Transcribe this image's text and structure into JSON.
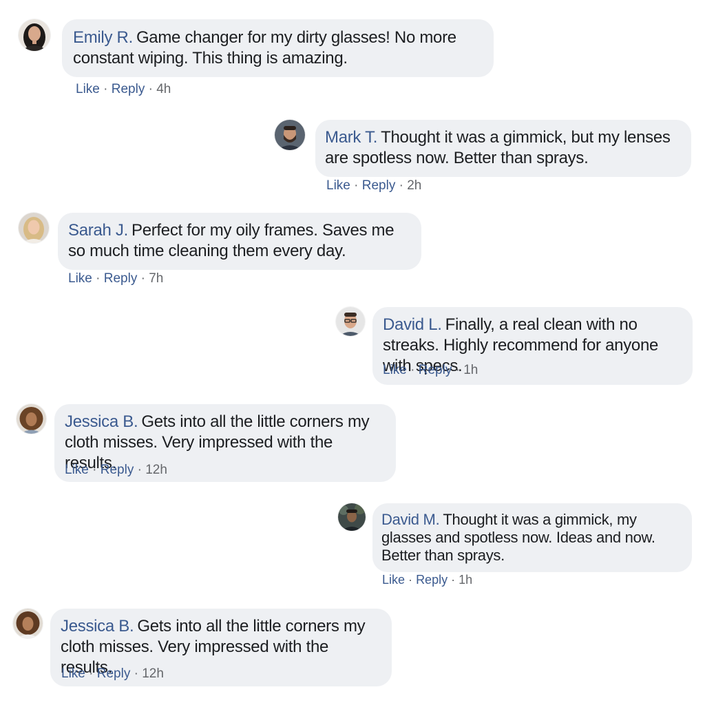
{
  "actions": {
    "like": "Like",
    "reply": "Reply",
    "separator": "·"
  },
  "comments": [
    {
      "author": "Emily R.",
      "text": "Game changer for my dirty glasses! No more constant wiping. This thing is amazing.",
      "time": "4h",
      "avatar": "avatar-emily-icon"
    },
    {
      "author": "Mark T.",
      "text": "Thought it was a gimmick, but my lenses are spotless now. Better than sprays.",
      "time": "2h",
      "avatar": "avatar-mark-icon"
    },
    {
      "author": "Sarah J.",
      "text": "Perfect for my oily frames. Saves me so much time cleaning them every day.",
      "time": "7h",
      "avatar": "avatar-sarah-icon"
    },
    {
      "author": "David L.",
      "text": "Finally, a real clean with no streaks. Highly recommend for anyone with specs.",
      "time": "1h",
      "avatar": "avatar-david-l-icon"
    },
    {
      "author": "Jessica B.",
      "text": "Gets into all the little corners my cloth misses. Very impressed with the results.",
      "time": "12h",
      "avatar": "avatar-jessica-icon"
    },
    {
      "author": "David M.",
      "text": "Thought it was a gimmick, my glasses and spotless now. Ideas and now. Better than sprays.",
      "time": "1h",
      "avatar": "avatar-david-m-icon"
    },
    {
      "author": "Jessica B.",
      "text": "Gets into all the little corners my cloth misses. Very impressed with the results.",
      "time": "12h",
      "avatar": "avatar-jessica-icon"
    }
  ],
  "colors": {
    "bubble": "#eef0f3",
    "author": "#3b5a8f",
    "meta": "#65676b",
    "text": "#1c1e21"
  }
}
